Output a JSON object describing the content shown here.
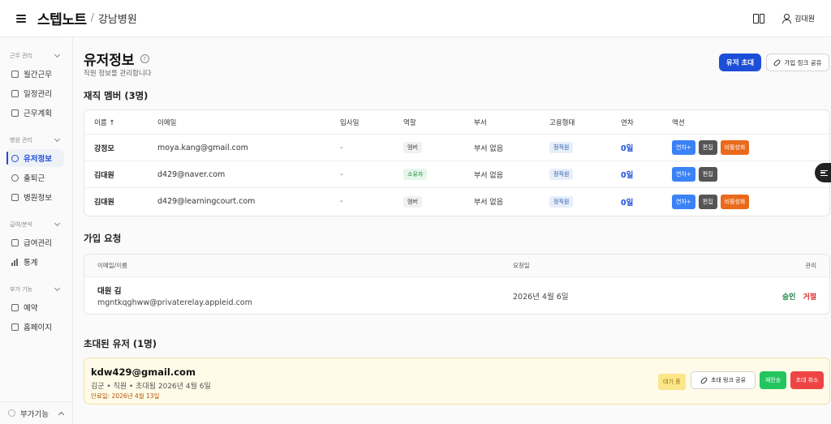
{
  "header": {
    "brand": "스텝노트",
    "separator": "/",
    "hospital": "강남병원",
    "user_name": "김대원"
  },
  "sidebar": {
    "groups": [
      {
        "label": "근무 관리",
        "items": [
          {
            "label": "월간근무"
          },
          {
            "label": "일정관리"
          },
          {
            "label": "근무계획"
          }
        ]
      },
      {
        "label": "병원 관리",
        "items": [
          {
            "label": "유저정보"
          },
          {
            "label": "출퇴근"
          },
          {
            "label": "병원정보"
          }
        ]
      },
      {
        "label": "급여/분석",
        "items": [
          {
            "label": "급여관리"
          },
          {
            "label": "통계"
          }
        ]
      },
      {
        "label": "부가 기능",
        "items": [
          {
            "label": "예약"
          },
          {
            "label": "홈페이지"
          }
        ]
      }
    ],
    "active_item": "유저정보",
    "bottom_label": "부가기능"
  },
  "page": {
    "title": "유저정보",
    "help": "?",
    "subtitle": "직원 정보를 관리합니다",
    "invite_button": "유저 초대",
    "share_button": "가입 링크 공유"
  },
  "members": {
    "title": "재직 멤버 (3명)",
    "columns": {
      "name": "이름 ↑",
      "email": "이메일",
      "join": "입사일",
      "role": "역할",
      "dept": "부서",
      "emp": "고용형태",
      "leave": "연차",
      "action": "액션"
    },
    "rows": [
      {
        "name": "강정모",
        "email": "moya.kang@gmail.com",
        "join": "-",
        "role": "멤버",
        "dept": "부서 없음",
        "emp": "정직원",
        "leave": "0일",
        "actions": [
          "연차+",
          "편집",
          "비활성화"
        ]
      },
      {
        "name": "김대원",
        "email": "d429@naver.com",
        "join": "-",
        "role": "소유자",
        "dept": "부서 없음",
        "emp": "정직원",
        "leave": "0일",
        "actions": [
          "연차+",
          "편집"
        ]
      },
      {
        "name": "김대원",
        "email": "d429@learningcourt.com",
        "join": "-",
        "role": "멤버",
        "dept": "부서 없음",
        "emp": "정직원",
        "leave": "0일",
        "actions": [
          "연차+",
          "편집",
          "비활성화"
        ]
      }
    ]
  },
  "join_requests": {
    "title": "가입 요청",
    "columns": {
      "email": "이메일/이름",
      "date": "요청일",
      "manage": "관리"
    },
    "rows": [
      {
        "name": "대원 김",
        "email": "mgntkqghww@privaterelay.appleid.com",
        "date": "2026년 4월 6일",
        "approve": "승인",
        "reject": "거절"
      }
    ]
  },
  "invited": {
    "title": "초대된 유저 (1명)",
    "email": "kdw429@gmail.com",
    "meta": "김군 • 직원 • 초대됨 2026년 4월 6일",
    "expiry": "만료일: 2026년 4월 13일",
    "status": "대기 중",
    "share": "초대 링크 공유",
    "resend": "재전송",
    "cancel": "초대 취소"
  }
}
